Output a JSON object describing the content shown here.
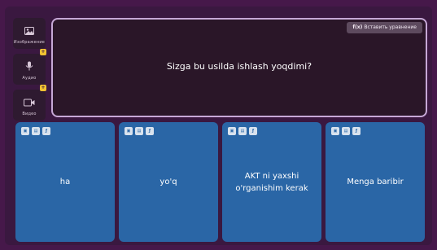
{
  "sidebar": {
    "items": [
      {
        "label": "Изображение",
        "icon": "image-icon",
        "has_badge": false
      },
      {
        "label": "Аудио",
        "icon": "microphone-icon",
        "has_badge": true
      },
      {
        "label": "Видео",
        "icon": "video-icon",
        "has_badge": true
      }
    ]
  },
  "question": {
    "text": "Sizga bu usilda ishlash yoqdimi?",
    "insert_equation_label": "Вставить уравнение",
    "insert_equation_icon_text": "f(x)"
  },
  "answer_tool_icons": [
    "image-icon",
    "media-icon",
    "equation-icon"
  ],
  "answers": [
    {
      "text": "ha"
    },
    {
      "text": "yo'q"
    },
    {
      "text": "AKT ni yaxshi o'rganishim kerak"
    },
    {
      "text": "Menga baribir"
    }
  ],
  "colors": {
    "background": "#46184a",
    "question_border": "#c6a8d6",
    "answer_card": "#2a66a6",
    "badge": "#f1c232"
  }
}
